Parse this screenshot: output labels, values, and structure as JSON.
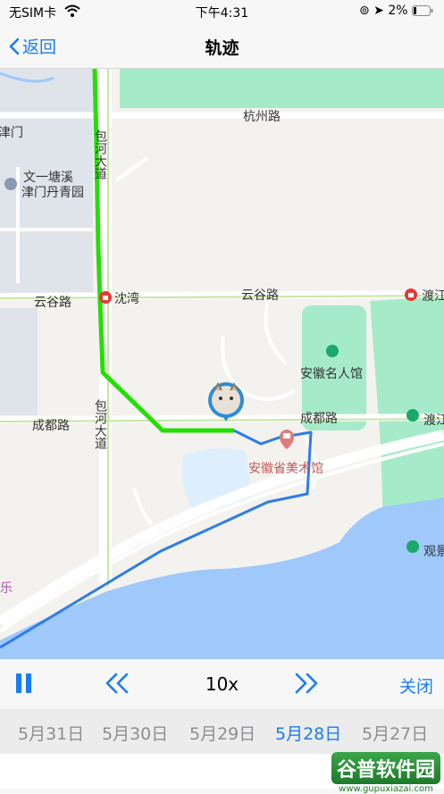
{
  "status_bar": {
    "carrier": "无SIM卡",
    "time": "下午4:31",
    "battery": "2%"
  },
  "nav": {
    "back_label": "返回",
    "title": "轨迹"
  },
  "map": {
    "labels": {
      "hangzhou_rd": "杭州路",
      "baohe_ave": "包河大道",
      "baohe_ave_s": "包河大道",
      "wenyi": "文一塘溪",
      "jinmen": "津门丹青园",
      "door": "津门",
      "yungu_w": "云谷路",
      "yungu_e": "云谷路",
      "shenwan": "沈湾",
      "dujiang_n": "渡江",
      "mingren": "安徽名人馆",
      "chengdu_w": "成都路",
      "chengdu_e": "成都路",
      "art_museum": "安徽省美术馆",
      "dujiang_s": "渡江",
      "guanjing": "观景",
      "le": "乐"
    },
    "colors": {
      "green_track": "#22e000",
      "blue_track": "#2d7de8",
      "water": "#9fc8fb",
      "park": "#a6ebc9"
    }
  },
  "controls": {
    "pause_icon": "pause-icon",
    "speed": "10x",
    "close_label": "关闭"
  },
  "dates": [
    "5月31日",
    "5月30日",
    "5月29日",
    "5月28日",
    "5月27日"
  ],
  "selected_date": "5月28日",
  "watermark": {
    "brand": "谷普软件园",
    "url": "www.gupuxiazai.com"
  }
}
